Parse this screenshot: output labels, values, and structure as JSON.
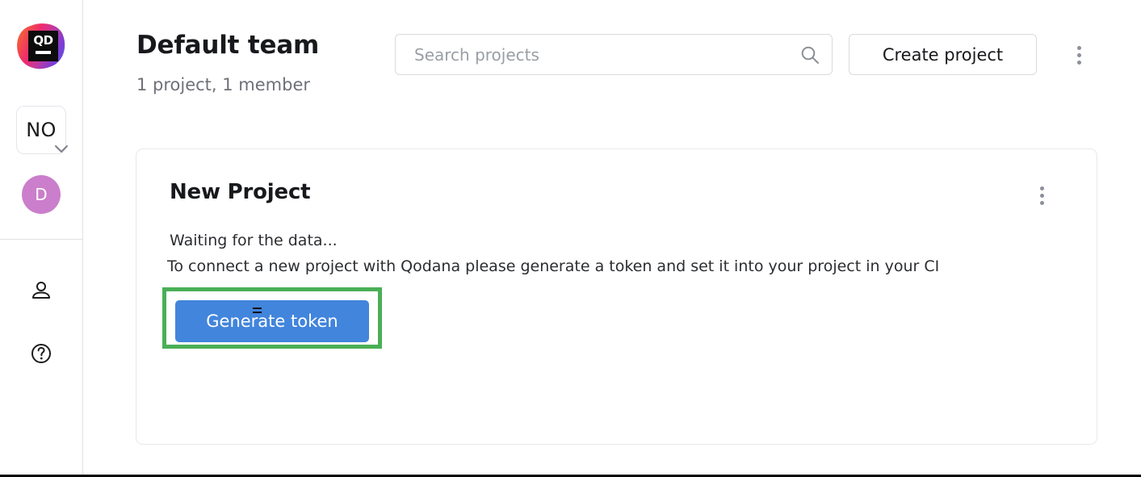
{
  "sidebar": {
    "logo": {
      "name": "qodana-logo",
      "text": "QD"
    },
    "org_switcher": {
      "label": "NO",
      "chevron_icon": "chevron-down-icon"
    },
    "user_avatar": {
      "initial": "D",
      "color": "#cb7ecb"
    },
    "nav_icons": [
      {
        "name": "profile-icon",
        "label": "Profile"
      },
      {
        "name": "help-icon",
        "label": "Help"
      }
    ]
  },
  "header": {
    "title": "Default team",
    "subtitle": "1 project, 1 member",
    "search": {
      "placeholder": "Search projects",
      "value": "",
      "icon": "search-icon"
    },
    "create_project_label": "Create project",
    "overflow_menu_icon": "more-vertical-icon"
  },
  "project_card": {
    "title": "New Project",
    "status": "Waiting for the data...",
    "hint": "To connect a new project with Qodana please generate a token and set it into your project in your CI",
    "generate_token_label": "Generate token",
    "overflow_menu_icon": "more-vertical-icon"
  },
  "colors": {
    "primary_button": "#4285dc",
    "highlight_border": "#4aaf56",
    "avatar": "#cb7ecb",
    "text_primary": "#18191c",
    "text_secondary": "#6e7177",
    "border": "#d8dbe0"
  }
}
